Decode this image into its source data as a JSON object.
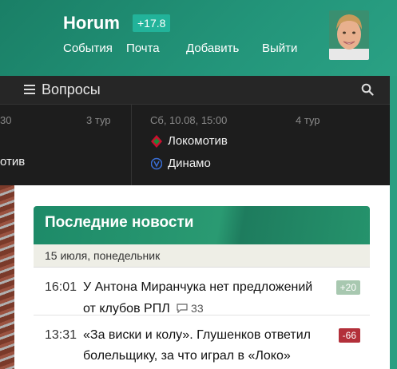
{
  "header": {
    "username": "Horum",
    "rating": "+17.8",
    "nav": [
      "События",
      "Почта",
      "Добавить",
      "Выйти"
    ]
  },
  "topbar": {
    "title": "Вопросы"
  },
  "matches": [
    {
      "date": "30",
      "round": "3 тур",
      "team2": "отив"
    },
    {
      "date": "Сб, 10.08, 15:00",
      "round": "4 тур",
      "team1": "Локомотив",
      "team2": "Динамо"
    }
  ],
  "news": {
    "title": "Последние новости",
    "date": "15 июля, понедельник",
    "items": [
      {
        "time": "16:01",
        "title": "У Антона Миранчука нет предложений от клубов РПЛ",
        "comments": "33",
        "score": "+20",
        "score_color": "#a8c8b0"
      },
      {
        "time": "13:31",
        "title": "«За виски и колу». Глушенков ответил болельщику, за что играл в «Локо»",
        "score": "-66",
        "score_color": "#b3303a"
      }
    ]
  },
  "colors": {
    "brand": "#1f8a6e",
    "rating_bg": "#22b39a",
    "dark_bar": "#1d1d1d"
  }
}
